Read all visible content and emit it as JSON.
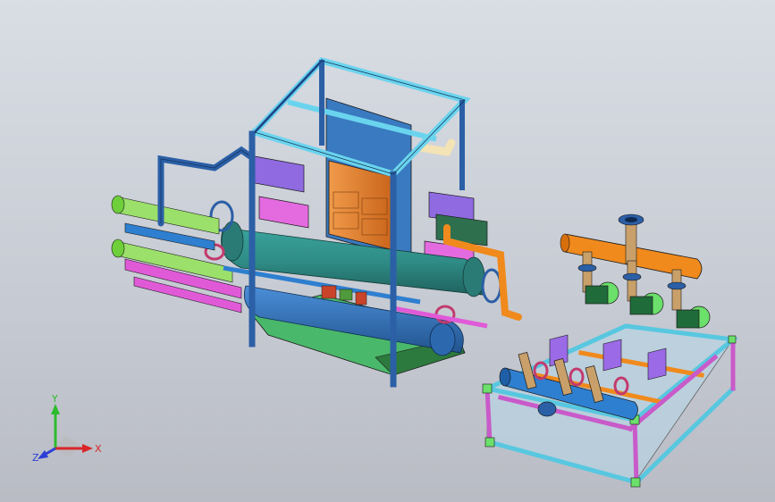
{
  "viewport": {
    "background_top": "#d9dde4",
    "background_bottom": "#b9bcc4"
  },
  "triad": {
    "x_label": "X",
    "y_label": "Y",
    "z_label": "Z",
    "x_color": "#d9262a",
    "y_color": "#2dbb2d",
    "z_color": "#2c3fd6"
  },
  "colors": {
    "frame_blue": "#2b5fa6",
    "frame_cyan": "#6ad4ee",
    "cabinet_orange": "#e07c2a",
    "vessel_teal": "#2f8c86",
    "pipe_blue": "#2e7fd0",
    "pipe_orange": "#f08a1c",
    "pipe_green": "#9be06a",
    "pipe_magenta": "#e05ad8",
    "pipe_purple": "#9b6ae6",
    "header_orange": "#f08a1c",
    "skid_magenta": "#c95ac9",
    "skid_cyan": "#58c7e0",
    "valve_green": "#6be06a"
  }
}
